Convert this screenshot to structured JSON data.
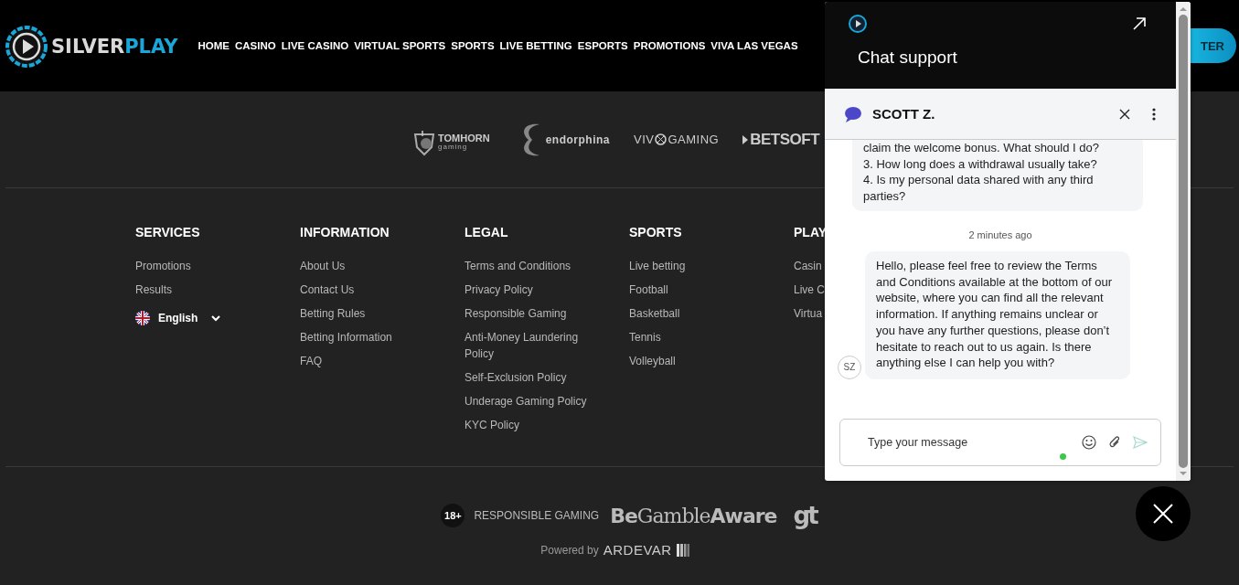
{
  "header": {
    "logo": {
      "parts": [
        "SILVER",
        "PLAY"
      ]
    },
    "nav": [
      "HOME",
      "CASINO",
      "LIVE CASINO",
      "VIRTUAL SPORTS",
      "SPORTS",
      "LIVE BETTING",
      "ESPORTS",
      "PROMOTIONS",
      "VIVA LAS VEGAS"
    ],
    "register_button": "TER"
  },
  "providers": [
    {
      "kind": "tomhorn",
      "text": "TOMHORN",
      "sub": "gaming"
    },
    {
      "kind": "endorphina",
      "text": "endorphina"
    },
    {
      "kind": "vivo",
      "text": "VIV",
      "sub": "GAMING"
    },
    {
      "kind": "betsoft",
      "text": "BETSOFT"
    }
  ],
  "footer_columns": [
    {
      "title": "SERVICES",
      "links": [
        "Promotions",
        "Results"
      ],
      "language": "English"
    },
    {
      "title": "INFORMATION",
      "links": [
        "About Us",
        "Contact Us",
        "Betting Rules",
        "Betting Information",
        "FAQ"
      ]
    },
    {
      "title": "LEGAL",
      "links": [
        "Terms and Conditions",
        "Privacy Policy",
        "Responsible Gaming",
        "Anti-Money Laundering Policy",
        "Self-Exclusion Policy",
        "Underage Gaming Policy",
        "KYC Policy"
      ]
    },
    {
      "title": "SPORTS",
      "links": [
        "Live betting",
        "Football",
        "Basketball",
        "Tennis",
        "Volleyball"
      ]
    },
    {
      "title": "PLAY",
      "links": [
        "Casin",
        "Live C",
        "Virtua"
      ]
    }
  ],
  "bottom": {
    "age_badge": "18+",
    "responsible": "RESPONSIBLE GAMING",
    "gamble_aware": "**Be**Gamble**Aware**",
    "gt_logo": "gt",
    "powered_by": "Powered by",
    "ardevar": "ARDEVAR"
  },
  "chat": {
    "title": "Chat support",
    "agent": "SCOTT Z.",
    "messages": [
      {
        "kind": "user",
        "lines": [
          "claim the welcome bonus. What should I do?",
          "3. How long does a withdrawal usually take?",
          "4. Is my personal data shared with any third parties?"
        ]
      },
      {
        "kind": "time",
        "text": "2 minutes ago"
      },
      {
        "kind": "agent",
        "avatar": "SZ",
        "text": "Hello, please feel free to review the Terms and Conditions available at the bottom of our website, where you can find all the relevant information. If anything remains unclear or you have any further questions, please don’t hesitate to reach out to us again. Is there anything else I can help you with?"
      }
    ],
    "input": {
      "placeholder": "Type your message",
      "online": true
    }
  }
}
